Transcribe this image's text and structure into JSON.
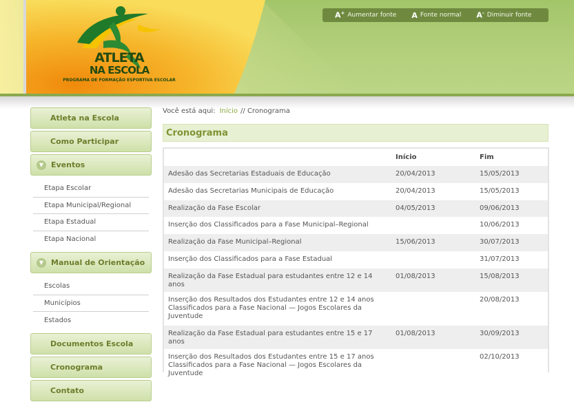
{
  "header": {
    "logo": {
      "line1": "ATLETA",
      "line2": "NA ESCOLA",
      "tagline": "PROGRAMA DE FORMAÇÃO ESPORTIVA ESCOLAR"
    },
    "font_controls": [
      {
        "label": "Aumentar fonte",
        "glyph": "A",
        "sup": "+"
      },
      {
        "label": "Fonte normal",
        "glyph": "A",
        "sup": ""
      },
      {
        "label": "Diminuir fonte",
        "glyph": "A",
        "sup": "-"
      }
    ]
  },
  "sidebar": {
    "top_items": [
      "Atleta na Escola",
      "Como Participar"
    ],
    "eventos": {
      "label": "Eventos",
      "items": [
        "Etapa Escolar",
        "Etapa Municipal/Regional",
        "Etapa Estadual",
        "Etapa Nacional"
      ]
    },
    "manual": {
      "label": "Manual de Orientação",
      "items": [
        "Escolas",
        "Municípios",
        "Estados"
      ]
    },
    "bottom_items": [
      "Documentos Escola",
      "Cronograma",
      "Contato"
    ]
  },
  "breadcrumb": {
    "prefix": "Você está aqui:",
    "home": "Início",
    "current": "// Cronograma"
  },
  "page_title": "Cronograma",
  "table": {
    "headers": [
      "",
      "Início",
      "Fim"
    ],
    "rows": [
      {
        "event": "Adesão das Secretarias Estaduais de Educação",
        "start": "20/04/2013",
        "end": "15/05/2013"
      },
      {
        "event": "Adesão das Secretarias Municipais de Educação",
        "start": "20/04/2013",
        "end": "15/05/2013"
      },
      {
        "event": "Realização da Fase Escolar",
        "start": "04/05/2013",
        "end": "09/06/2013"
      },
      {
        "event": "Inserção dos Classificados para a Fase Municipal–Regional",
        "start": "",
        "end": "10/06/2013"
      },
      {
        "event": "Realização da Fase Municipal–Regional",
        "start": "15/06/2013",
        "end": "30/07/2013"
      },
      {
        "event": "Inserção dos Classificados para a Fase Estadual",
        "start": "",
        "end": "31/07/2013"
      },
      {
        "event": "Realização da Fase Estadual para estudantes entre 12 e 14 anos",
        "start": "01/08/2013",
        "end": "15/08/2013"
      },
      {
        "event": "Inserção dos Resultados dos Estudantes entre 12 e 14 anos Classificados para a Fase Nacional — Jogos Escolares da Juventude",
        "start": "",
        "end": "20/08/2013"
      },
      {
        "event": "Realização da Fase Estadual para estudantes entre 15 e 17 anos",
        "start": "01/08/2013",
        "end": "30/09/2013"
      },
      {
        "event": "Inserção dos Resultados dos Estudantes entre 15 e 17 anos Classificados para a Fase Nacional — Jogos Escolares da Juventude",
        "start": "",
        "end": "02/10/2013"
      }
    ]
  },
  "colors": {
    "header_green": "#a3c56a",
    "accent_green": "#7e9434",
    "logo_orange": "#f39c12",
    "logo_yellow": "#f7dc3a"
  }
}
